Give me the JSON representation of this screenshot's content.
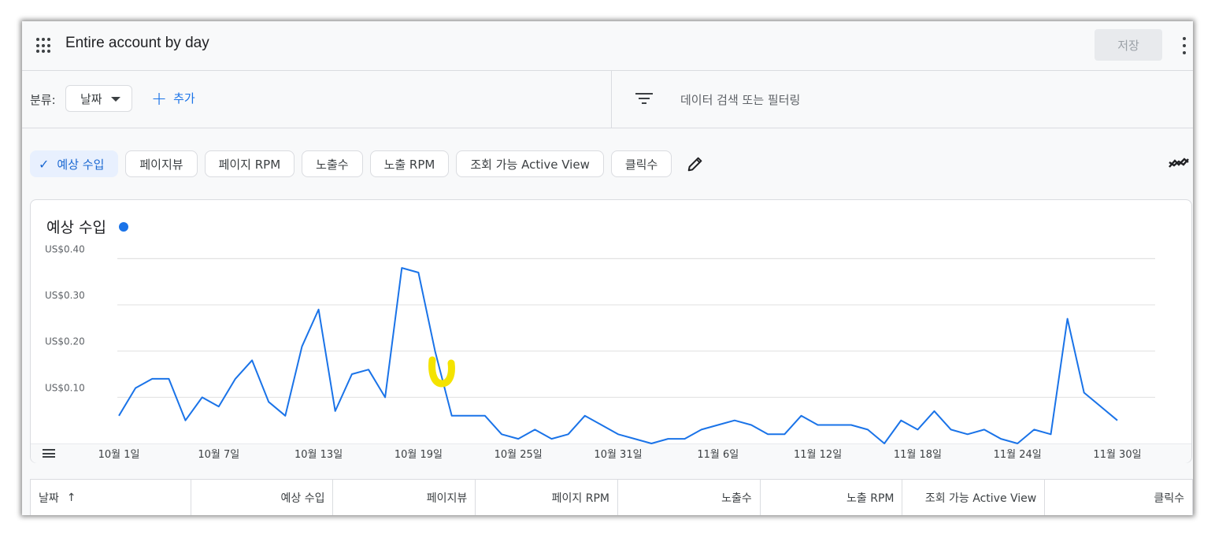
{
  "header": {
    "title": "Entire account by day",
    "save_label": "저장"
  },
  "filterbar": {
    "classification_label": "분류:",
    "dimension_value": "날짜",
    "add_label": "추가",
    "search_placeholder": "데이터 검색 또는 필터링"
  },
  "metric_chips": [
    {
      "label": "예상 수입",
      "selected": true
    },
    {
      "label": "페이지뷰",
      "selected": false
    },
    {
      "label": "페이지 RPM",
      "selected": false
    },
    {
      "label": "노출수",
      "selected": false
    },
    {
      "label": "노출 RPM",
      "selected": false
    },
    {
      "label": "조회 가능 Active View",
      "selected": false
    },
    {
      "label": "클릭수",
      "selected": false
    }
  ],
  "colors": {
    "accent": "#1a73e8",
    "selected_chip_bg": "#e8f0fe",
    "highlight_mark": "#f4e300"
  },
  "chart": {
    "title": "예상 수입"
  },
  "chart_data": {
    "type": "line",
    "title": "예상 수입",
    "series": [
      {
        "name": "예상 수입",
        "color": "#1a73e8",
        "values": [
          0.06,
          0.12,
          0.14,
          0.14,
          0.05,
          0.1,
          0.08,
          0.14,
          0.18,
          0.09,
          0.06,
          0.21,
          0.29,
          0.07,
          0.15,
          0.16,
          0.1,
          0.38,
          0.37,
          0.2,
          0.06,
          0.06,
          0.06,
          0.02,
          0.01,
          0.03,
          0.01,
          0.02,
          0.06,
          0.04,
          0.02,
          0.01,
          0.0,
          0.01,
          0.01,
          0.03,
          0.04,
          0.05,
          0.04,
          0.02,
          0.02,
          0.06,
          0.04,
          0.04,
          0.04,
          0.03,
          0.0,
          0.05,
          0.03,
          0.07,
          0.03,
          0.02,
          0.03,
          0.01,
          0.0,
          0.03,
          0.02,
          0.27,
          0.11,
          0.08,
          0.05
        ]
      }
    ],
    "x_start_label": "10월 1일",
    "x_tick_labels": [
      "10월 1일",
      "10월 7일",
      "10월 13일",
      "10월 19일",
      "10월 25일",
      "10월 31일",
      "11월 6일",
      "11월 12일",
      "11월 18일",
      "11월 24일",
      "11월 30일"
    ],
    "y_tick_labels": [
      "US$0.10",
      "US$0.20",
      "US$0.30",
      "US$0.40"
    ],
    "y_ticks": [
      0.1,
      0.2,
      0.3,
      0.4
    ],
    "ylim": [
      0,
      0.4
    ],
    "grid": true
  },
  "table": {
    "columns": [
      "날짜",
      "예상 수입",
      "페이지뷰",
      "페이지 RPM",
      "노출수",
      "노출 RPM",
      "조회 가능 Active View",
      "클릭수"
    ]
  }
}
